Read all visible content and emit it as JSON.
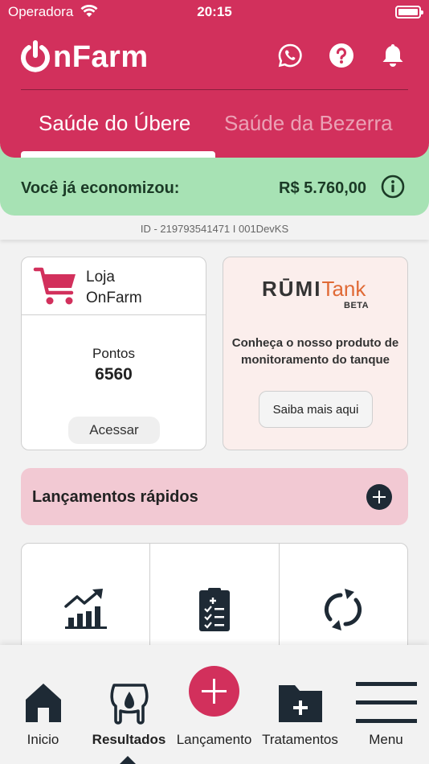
{
  "status_bar": {
    "carrier": "Operadora",
    "time": "20:15"
  },
  "header": {
    "logo_text": "nFarm",
    "tabs": [
      {
        "label": "Saúde do Úbere",
        "active": true
      },
      {
        "label": "Saúde da Bezerra",
        "active": false
      }
    ],
    "icons": [
      "whatsapp-icon",
      "help-icon",
      "bell-icon"
    ]
  },
  "savings": {
    "label": "Você já economizou:",
    "value": "R$ 5.760,00"
  },
  "id_line": "ID - 219793541471 I 001DevKS",
  "loja": {
    "title_line1": "Loja",
    "title_line2": "OnFarm",
    "points_label": "Pontos",
    "points_value": "6560",
    "button_label": "Acessar"
  },
  "rumi": {
    "brand_left": "RŪMI",
    "brand_right": "Tank",
    "badge": "BETA",
    "description": "Conheça o nosso produto de monitoramento do tanque",
    "button_label": "Saiba mais aqui"
  },
  "quick": {
    "label": "Lançamentos rápidos"
  },
  "shortcuts": [
    "chart-growth-icon",
    "checklist-icon",
    "refresh-icon"
  ],
  "nav": [
    {
      "label": "Inicio",
      "icon": "home-icon"
    },
    {
      "label": "Resultados",
      "icon": "udder-icon",
      "active": true
    },
    {
      "label": "Lançamento",
      "icon": "add-circle-icon"
    },
    {
      "label": "Tratamentos",
      "icon": "folder-add-icon"
    },
    {
      "label": "Menu",
      "icon": "menu-icon"
    }
  ],
  "colors": {
    "brand": "#d2305c",
    "savings_bg": "#a7e2b4",
    "quick_bg": "#f2c9d3",
    "rumi_bg": "#fbeeec",
    "dark": "#1e2a35",
    "rumi_orange": "#e06a36"
  }
}
